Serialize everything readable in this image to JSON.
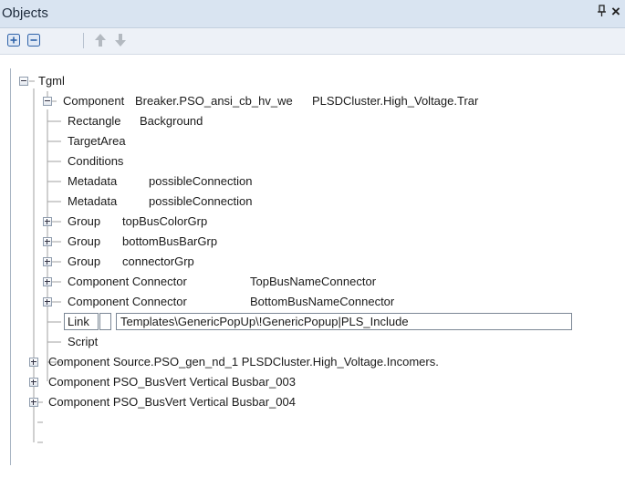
{
  "panel": {
    "title": "Objects",
    "pin_glyph": "■",
    "close_glyph": "×"
  },
  "toolbar": {
    "expand_all": "expand-all-icon",
    "collapse_all": "collapse-all-icon",
    "move_up": "arrow-up-icon",
    "move_down": "arrow-down-icon"
  },
  "tree": {
    "root": "Tgml",
    "breaker": {
      "kind": "Component",
      "name": "Breaker.PSO_ansi_cb_hv_we",
      "path": "PLSDCluster.High_Voltage.Trar"
    },
    "children": [
      {
        "type": "Rectangle",
        "name": "Background"
      },
      {
        "type": "TargetArea",
        "name": ""
      },
      {
        "type": "Conditions",
        "name": ""
      },
      {
        "type": "Metadata",
        "name": "possibleConnection"
      },
      {
        "type": "Metadata",
        "name": "possibleConnection"
      },
      {
        "type": "Group",
        "name": "topBusColorGrp"
      },
      {
        "type": "Group",
        "name": "bottomBusBarGrp"
      },
      {
        "type": "Group",
        "name": "connectorGrp"
      },
      {
        "type": "Component Connector",
        "name": "TopBusNameConnector"
      },
      {
        "type": "Component Connector",
        "name": "BottomBusNameConnector"
      },
      {
        "type": "Link",
        "name": "",
        "value": "Templates\\GenericPopUp\\!GenericPopup|PLS_Include"
      },
      {
        "type": "Script",
        "name": ""
      }
    ],
    "siblings": [
      "Component Source.PSO_gen_nd_1  PLSDCluster.High_Voltage.Incomers.",
      "Component PSO_BusVert  Vertical Busbar_003",
      "Component PSO_BusVert  Vertical Busbar_004"
    ]
  },
  "colors": {
    "title_bar": "#d9e4f1",
    "toolbar": "#edf1f7",
    "tree_line": "#a0a0a0",
    "arrow": "#b3b9c0",
    "tb_icon": "#2f63a9"
  }
}
